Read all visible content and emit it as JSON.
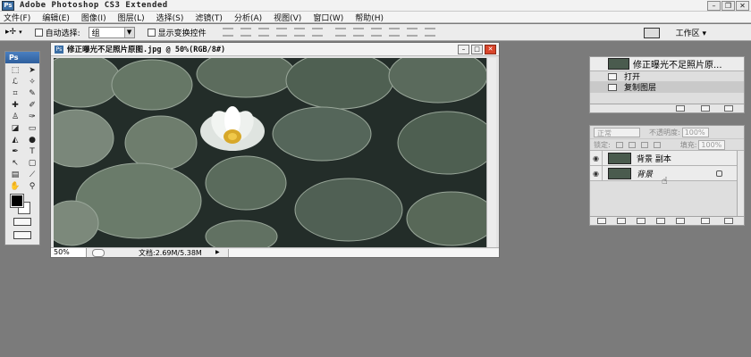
{
  "window": {
    "title": "Adobe Photoshop CS3 Extended",
    "logo": "Ps"
  },
  "menu": {
    "items": [
      "文件(F)",
      "编辑(E)",
      "图像(I)",
      "图层(L)",
      "选择(S)",
      "滤镜(T)",
      "分析(A)",
      "视图(V)",
      "窗口(W)",
      "帮助(H)"
    ]
  },
  "options": {
    "auto_select_label": "自动选择:",
    "auto_select_value": "组",
    "show_transform_label": "显示变换控件",
    "workspace_label": "工作区 ▾"
  },
  "toolbox": {
    "label": "Ps"
  },
  "document": {
    "title": "修正曝光不足照片原图.jpg @ 50%(RGB/8#)",
    "zoom": "50%",
    "doc_size": "文档:2.69M/5.38M"
  },
  "history": {
    "snapshot_label": "修正曝光不足照片原...",
    "items": [
      "打开",
      "复制图层"
    ]
  },
  "layers": {
    "blend_mode": "正常",
    "opacity_label": "不透明度:",
    "opacity_value": "100%",
    "lock_label": "锁定:",
    "fill_label": "填充:",
    "fill_value": "100%",
    "items": [
      {
        "name": "背景 副本"
      },
      {
        "name": "背景"
      }
    ]
  },
  "colors": {
    "accent": "#2f5f9d",
    "close": "#d9452b",
    "canvas_dark": "#2a3530",
    "lily_pad": "#5f7163"
  }
}
